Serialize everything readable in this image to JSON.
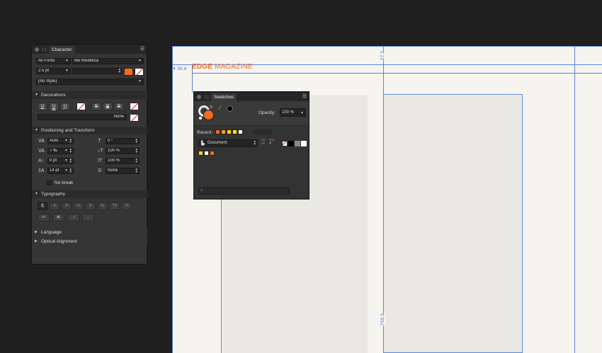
{
  "canvas": {
    "brand_primary": "EDGE",
    "brand_secondary": "MAGAZINE",
    "brand_color": "#f0702a",
    "measure_left": "30.4",
    "measure_top": "27.3",
    "measure_height": "750.3"
  },
  "character": {
    "tab_label": "Character",
    "font_collection": "All Fonts",
    "font_family": "Bw Modelica",
    "font_size": "2.5 pt",
    "font_style": "",
    "paragraph_style": "[No Style]",
    "text_fill_color": "#f26b21",
    "decorations": {
      "label": "Decorations",
      "underline": "U",
      "double_underline": "U",
      "dotted_underline": "U",
      "strike": "S",
      "double_strike": "S",
      "outline_strike": "S",
      "line_style": "None"
    },
    "positioning": {
      "label": "Positioning and Transform",
      "kerning": "Auto",
      "tracking": "7 ‰",
      "baseline": "0 pt",
      "leading": "14 pt",
      "shear": "0 °",
      "vertical_scale": "100 %",
      "horizontal_scale": "100 %",
      "alignment": "None",
      "no_break_label": "No break"
    },
    "typography": {
      "label": "Typography",
      "row1": [
        "fi",
        "ß",
        "1ª",
        "½",
        "S'",
        "S,",
        "TT",
        "Tr"
      ],
      "row2_more": "..."
    },
    "language_label": "Language",
    "optical_alignment_label": "Optical Alignment"
  },
  "swatches": {
    "tab_label": "Swatches",
    "fill_color": "#f26b21",
    "opacity_label": "Opacity:",
    "opacity_value": "100 %",
    "recent_label": "Recent:",
    "recent_colors": [
      "#f26b21",
      "#f7a21b",
      "#ffd21f",
      "#ffe600",
      "#ffffff"
    ],
    "palette_name": "Document",
    "document_colors": [
      "#ffd21f",
      "#ffffff",
      "#f26b21"
    ],
    "search_placeholder": ""
  }
}
